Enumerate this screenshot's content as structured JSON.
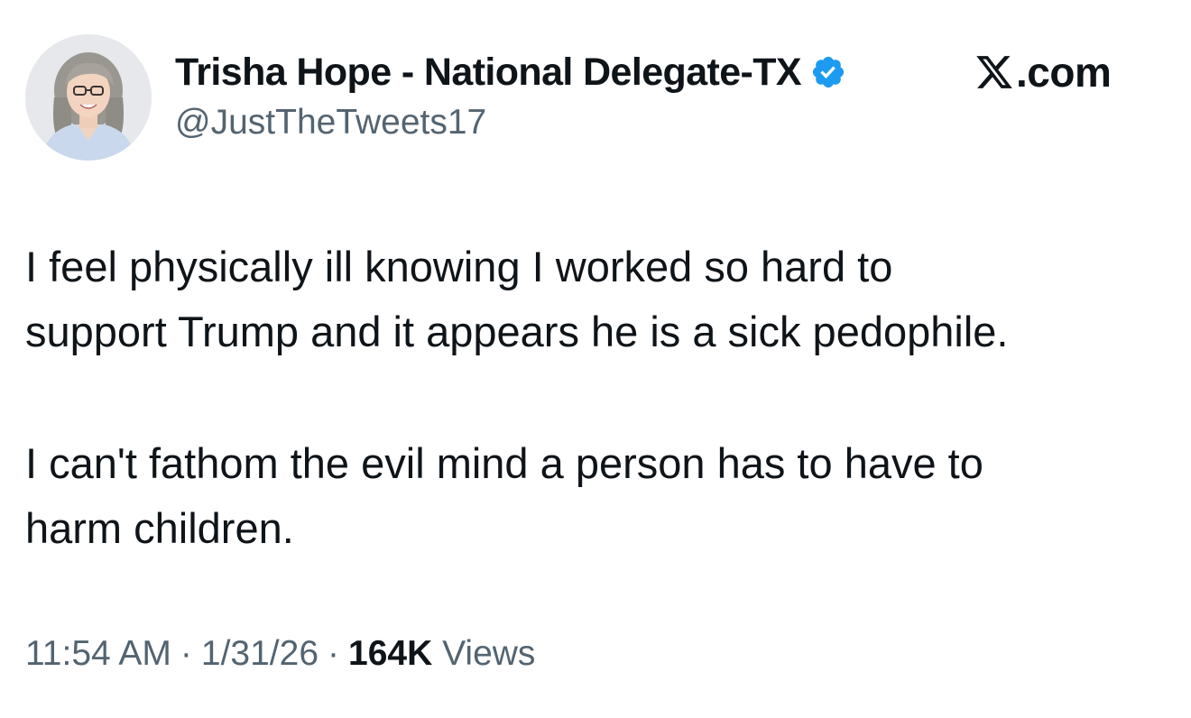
{
  "author": {
    "display_name": "Trisha Hope - National Delegate-TX",
    "handle": "@JustTheTweets17",
    "verified": true,
    "verified_color": "#1d9bf0",
    "avatar_icon": "profile-photo"
  },
  "brand": {
    "logo_icon": "x-logo-icon",
    "text": ".com"
  },
  "tweet": {
    "line_1": "I feel physically ill knowing I worked so hard to",
    "line_2": "support Trump and it appears he is a sick pedophile.",
    "line_3": "I can't fathom the evil mind a person has to have to",
    "line_4": "harm children."
  },
  "meta": {
    "time": "11:54 AM",
    "separator": "·",
    "date": "1/31/26",
    "views_count": "164K",
    "views_label": "Views"
  },
  "colors": {
    "text_primary": "#0f1419",
    "text_secondary": "#536471",
    "background": "#ffffff"
  }
}
